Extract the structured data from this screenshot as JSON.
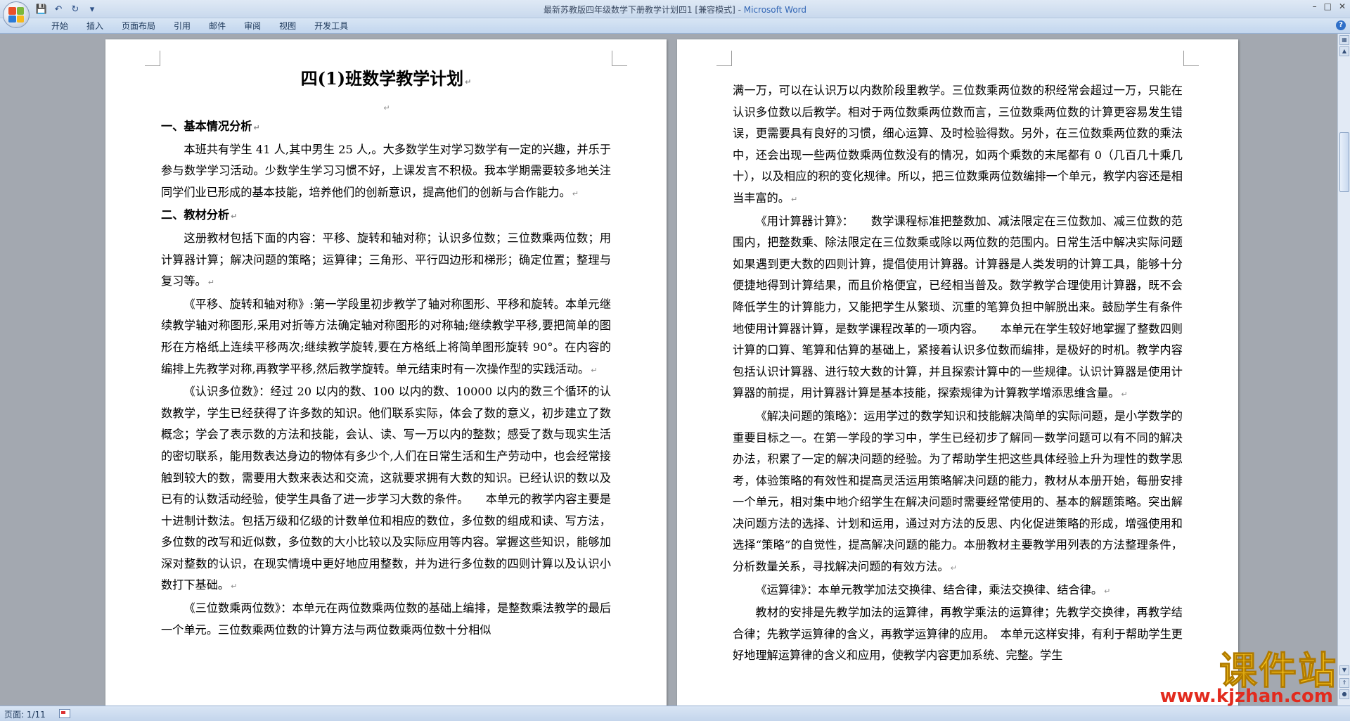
{
  "window": {
    "doc_title": "最新苏教版四年级数学下册教学计划四1 [兼容模式]",
    "separator": " - ",
    "app_name": "Microsoft Word"
  },
  "quick_access": [
    {
      "name": "save-icon",
      "glyph": "💾"
    },
    {
      "name": "undo-icon",
      "glyph": "↶"
    },
    {
      "name": "redo-icon",
      "glyph": "↻"
    },
    {
      "name": "customize-icon",
      "glyph": "▾"
    }
  ],
  "ribbon": {
    "tabs": [
      "开始",
      "插入",
      "页面布局",
      "引用",
      "邮件",
      "审阅",
      "视图",
      "开发工具"
    ]
  },
  "status": {
    "page_label": "页面: 1/11"
  },
  "watermark": {
    "cn": "课件站",
    "url": "www.kjzhan.com"
  },
  "colors": {
    "accent": "#3165b4",
    "watermark_yellow": "#f6c21a",
    "watermark_red": "#e22b1e"
  },
  "left_page": {
    "title": "四(1)班数学教学计划",
    "h1": "一、基本情况分析",
    "p1": "本班共有学生 41 人,其中男生 25 人,。大多数学生对学习数学有一定的兴趣，并乐于参与数学学习活动。少数学生学习习惯不好，上课发言不积极。我本学期需要较多地关注同学们业已形成的基本技能，培养他们的创新意识，提高他们的创新与合作能力。",
    "h2": "二、教材分析",
    "p2": "这册教材包括下面的内容：平移、旋转和轴对称；认识多位数；三位数乘两位数；用计算器计算；解决问题的策略；运算律；三角形、平行四边形和梯形；确定位置；整理与复习等。",
    "p3": "《平移、旋转和轴对称》:第一学段里初步教学了轴对称图形、平移和旋转。本单元继续教学轴对称图形,采用对折等方法确定轴对称图形的对称轴;继续教学平移,要把简单的图形在方格纸上连续平移两次;继续教学旋转,要在方格纸上将简单图形旋转 90°。在内容的编排上先教学对称,再教学平移,然后教学旋转。单元结束时有一次操作型的实践活动。",
    "p4": "《认识多位数》：经过 20 以内的数、100 以内的数、10000 以内的数三个循环的认数教学，学生已经获得了许多数的知识。他们联系实际，体会了数的意义，初步建立了数概念；学会了表示数的方法和技能，会认、读、写一万以内的整数；感受了数与现实生活的密切联系，能用数表达身边的物体有多少个,人们在日常生活和生产劳动中，也会经常接触到较大的数，需要用大数来表达和交流，这就要求拥有大数的知识。已经认识的数以及已有的认数活动经验，使学生具备了进一步学习大数的条件。　　本单元的教学内容主要是十进制计数法。包括万级和亿级的计数单位和相应的数位，多位数的组成和读、写方法，多位数的改写和近似数，多位数的大小比较以及实际应用等内容。掌握这些知识，能够加深对整数的认识，在现实情境中更好地应用整数，并为进行多位数的四则计算以及认识小数打下基础。",
    "p5": "《三位数乘两位数》：本单元在两位数乘两位数的基础上编排，是整数乘法教学的最后一个单元。三位数乘两位数的计算方法与两位数乘两位数十分相似"
  },
  "right_page": {
    "p1": "满一万，可以在认识万以内数阶段里教学。三位数乘两位数的积经常会超过一万，只能在认识多位数以后教学。相对于两位数乘两位数而言，三位数乘两位数的计算更容易发生错误，更需要具有良好的习惯，细心运算、及时检验得数。另外，在三位数乘两位数的乘法中，还会出现一些两位数乘两位数没有的情况，如两个乘数的末尾都有 0（几百几十乘几十），以及相应的积的变化规律。所以，把三位数乘两位数编排一个单元，教学内容还是相当丰富的。",
    "p2": "《用计算器计算》：　　数学课程标准把整数加、减法限定在三位数加、减三位数的范围内，把整数乘、除法限定在三位数乘或除以两位数的范围内。日常生活中解决实际问题如果遇到更大数的四则计算，提倡使用计算器。计算器是人类发明的计算工具，能够十分便捷地得到计算结果，而且价格便宜，已经相当普及。数学教学合理使用计算器，既不会降低学生的计算能力，又能把学生从繁琐、沉重的笔算负担中解脱出来。鼓励学生有条件地使用计算器计算，是数学课程改革的一项内容。　　本单元在学生较好地掌握了整数四则计算的口算、笔算和估算的基础上，紧接着认识多位数而编排，是极好的时机。教学内容包括认识计算器、进行较大数的计算，并且探索计算中的一些规律。认识计算器是使用计算器的前提，用计算器计算是基本技能，探索规律为计算教学增添思维含量。",
    "p3": "《解决问题的策略》：运用学过的数学知识和技能解决简单的实际问题，是小学数学的重要目标之一。在第一学段的学习中，学生已经初步了解同一数学问题可以有不同的解决办法，积累了一定的解决问题的经验。为了帮助学生把这些具体经验上升为理性的数学思考，体验策略的有效性和提高灵活运用策略解决问题的能力，教材从本册开始，每册安排一个单元，相对集中地介绍学生在解决问题时需要经常使用的、基本的解题策略。突出解决问题方法的选择、计划和运用，通过对方法的反思、内化促进策略的形成，增强使用和选择“策略”的自觉性，提高解决问题的能力。本册教材主要教学用列表的方法整理条件，分析数量关系，寻找解决问题的有效方法。",
    "p4": "《运算律》：本单元教学加法交换律、结合律，乘法交换律、结合律。",
    "p5": "教材的安排是先教学加法的运算律，再教学乘法的运算律；先教学交换律，再教学结合律；先教学运算律的含义，再教学运算律的应用。　本单元这样安排，有利于帮助学生更好地理解运算律的含义和应用，使教学内容更加系统、完整。学生"
  }
}
